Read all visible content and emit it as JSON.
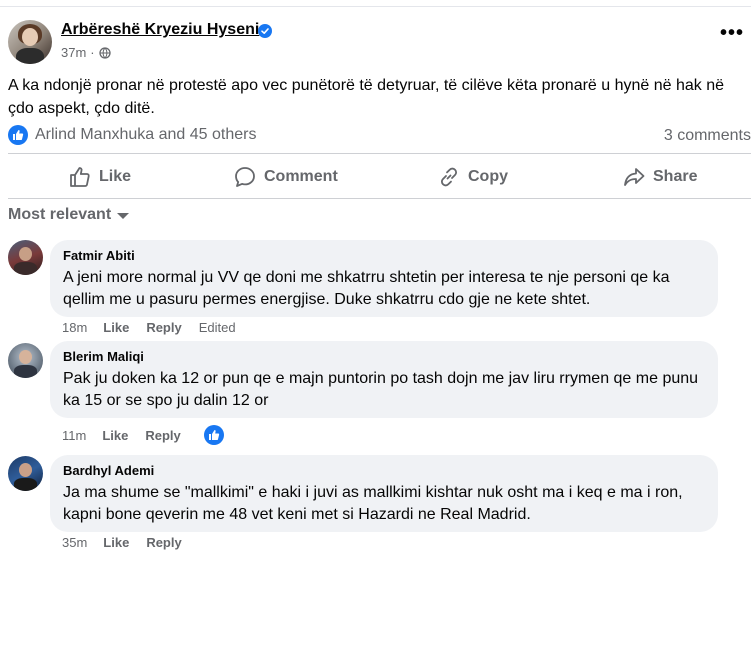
{
  "post": {
    "author": "Arbëreshë Kryeziu Hyseni",
    "time": "37m",
    "text": "A ka ndonjë pronar në protestë apo vec punëtorë të detyruar, të cilëve këta pronarë u hynë në hak në çdo aspekt, çdo ditë.",
    "reactions_text": "Arlind Manxhuka and 45 others",
    "comments_count": "3 comments",
    "more_label": "•••"
  },
  "actions": {
    "like": "Like",
    "comment": "Comment",
    "copy": "Copy",
    "share": "Share"
  },
  "sort_label": "Most relevant",
  "comments": [
    {
      "name": "Fatmir Abiti",
      "text": "A jeni more normal ju VV qe doni me shkatrru shtetin per interesa te nje personi qe ka qellim me u pasuru permes energjise. Duke shkatrru cdo gje ne kete shtet.",
      "time": "18m",
      "like": "Like",
      "reply": "Reply",
      "edited": "Edited"
    },
    {
      "name": "Blerim Maliqi",
      "text": "Pak ju doken ka 12 or pun qe e majn puntorin po tash dojn me jav liru rrymen qe me punu ka 15 or se spo ju dalin 12 or",
      "time": "11m",
      "like": "Like",
      "reply": "Reply"
    },
    {
      "name": "Bardhyl Ademi",
      "text": "Ja ma shume se \"mallkimi\" e haki i juvi as mallkimi kishtar nuk osht ma i keq e ma i ron, kapni bone qeverin me 48 vet keni met si Hazardi ne Real Madrid.",
      "time": "35m",
      "like": "Like",
      "reply": "Reply"
    }
  ],
  "colors": {
    "accent": "#1877f2",
    "secondary_text": "#65676b",
    "bubble_bg": "#f0f2f5"
  },
  "icons": [
    "verified-badge-icon",
    "globe-icon",
    "more-icon",
    "like-reaction-icon",
    "thumbs-up-icon",
    "comment-icon",
    "link-icon",
    "share-icon",
    "caret-down-icon"
  ]
}
